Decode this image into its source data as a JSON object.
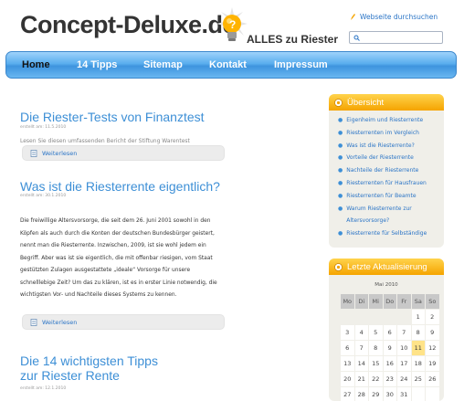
{
  "header": {
    "site_title": "Concept-Deluxe.de",
    "tagline": "ALLES zu Riester",
    "search_link": "Webseite durchsuchen",
    "search_value": ""
  },
  "colors": {
    "accent": "#3d8fd6",
    "nav": "#5aaeee",
    "sidebar_head": "#f5a400"
  },
  "nav": {
    "items": [
      {
        "label": "Home",
        "active": true
      },
      {
        "label": "14 Tipps"
      },
      {
        "label": "Sitemap"
      },
      {
        "label": "Kontakt"
      },
      {
        "label": "Impressum"
      }
    ]
  },
  "posts": [
    {
      "title": "Die Riester-Tests von Finanztest",
      "meta": "erstellt am: 11.5.2010",
      "excerpt": "Lesen Sie diesen umfassenden Bericht der Stiftung Warentest",
      "more": "Weiterlesen"
    },
    {
      "title": "Was ist die Riesterrente eigentlich?",
      "meta": "erstellt am: 30.1.2010",
      "body_lines": [
        "Die freiwillige Altersvorsorge, die seit dem 26. Juni 2001 sowohl in den",
        "Köpfen als auch durch die Konten der deutschen Bundesbürger geistert,",
        "nennt man die Riesterrente. Inzwischen, 2009, ist sie wohl jedem ein",
        "Begriff. Aber was ist sie eigentlich, die mit offenbar riesigen, vom Staat",
        "gestützten Zulagen ausgestattete „ideale“ Vorsorge für unsere",
        "schnelllebige Zeit? Um das zu klären, ist es in erster Linie notwendig, die",
        "wichtigsten Vor- und Nachteile dieses Systems zu kennen."
      ],
      "more": "Weiterlesen"
    },
    {
      "title_line1": "Die 14 wichtigsten Tipps",
      "title_line2": "zur Riester Rente",
      "meta": "erstellt am: 12.1.2010"
    }
  ],
  "sidebar": {
    "overview": {
      "title": "Übersicht",
      "items": [
        "Eigenheim und Riesterrente",
        "Riesterrenten im Vergleich",
        "Was ist die Riesterrente?",
        "Vorteile der Riesterrente",
        "Nachteile der Riesterrente",
        "Riesterrenten für Hausfrauen",
        "Riesterrenten für Beamte",
        "Warum Riesterrente zur",
        "Altersvorsorge?",
        "Riesterrente für Selbständige"
      ]
    },
    "updates": {
      "title": "Letzte Aktualisierung",
      "calendar": {
        "month": "Mai 2010",
        "weekdays": [
          "Mo",
          "Di",
          "Mi",
          "Do",
          "Fr",
          "Sa",
          "So"
        ],
        "weeks": [
          [
            "",
            "",
            "",
            "",
            "",
            "1",
            "2"
          ],
          [
            "3",
            "4",
            "5",
            "6",
            "7",
            "8",
            "9"
          ],
          [
            "6",
            "7",
            "8",
            "9",
            "10",
            "11",
            "12"
          ],
          [
            "13",
            "14",
            "15",
            "16",
            "17",
            "18",
            "19"
          ],
          [
            "20",
            "21",
            "22",
            "23",
            "24",
            "25",
            "26"
          ],
          [
            "27",
            "28",
            "29",
            "30",
            "31",
            "",
            ""
          ]
        ],
        "today": "11"
      }
    }
  }
}
